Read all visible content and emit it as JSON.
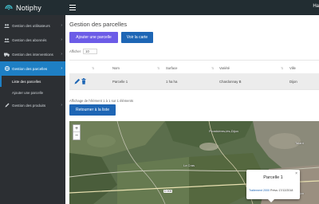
{
  "app": {
    "name": "Notiphy",
    "user": "Ha"
  },
  "sidebar": {
    "items": [
      {
        "label": "Gestion des utilisateurs",
        "icon": "users-icon"
      },
      {
        "label": "Gestion des abonnés",
        "icon": "users-icon"
      },
      {
        "label": "Gestion des interventions",
        "icon": "truck-icon"
      },
      {
        "label": "Gestion des parcelles",
        "icon": "globe-icon"
      },
      {
        "label": "Gestion des produits",
        "icon": "pencil-icon"
      }
    ],
    "subitems": [
      {
        "label": "Liste des parcelles"
      },
      {
        "label": "Ajouter une parcelle"
      }
    ],
    "chevron": "›"
  },
  "main": {
    "title": "Gestion des parcelles",
    "add_button": "Ajouter une parcelle",
    "map_button": "Voir la carte",
    "show_label": "Afficher",
    "show_value": "10",
    "columns": [
      "Nom",
      "Surface",
      "Variété",
      "Ville"
    ],
    "rows": [
      {
        "nom": "Parcelle 1",
        "surface": "1 ha ha",
        "variete": "Chardonnay B",
        "ville": "Dijon"
      }
    ],
    "info": "Affichage de l'élément 1 à 1 sur 1 éléments",
    "back_button": "Retourner à la liste"
  },
  "map": {
    "zoom_in": "+",
    "zoom_out": "−",
    "labels": {
      "talant": "Talant",
      "la_cras": "La Cras",
      "plombieres": "Plombières-lès-Dijon",
      "dijon": "Dijon"
    },
    "road": "D 905",
    "popup": {
      "title": "Parcelle 1",
      "close": "×",
      "link_text": "Traitement 2000",
      "status": "Prévu",
      "date": "17/12/2018"
    }
  },
  "colors": {
    "accent": "#1e7fc4",
    "purple": "#6c5ce7",
    "sidebar": "#2c2f33",
    "topbar": "#222d32"
  }
}
